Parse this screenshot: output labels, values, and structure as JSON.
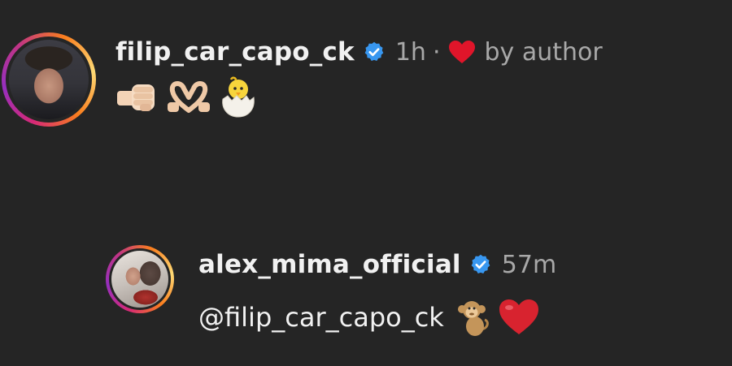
{
  "colors": {
    "background": "#252525",
    "username_text": "#f1f1f1",
    "secondary_text": "#a8a8a8",
    "verified_badge": "#3897f0",
    "heart": "#e0152a"
  },
  "comment": {
    "username": "filip_car_capo_ck",
    "verified_icon": "verified-badge-icon",
    "time": "1h",
    "separator": "·",
    "liked_icon": "heart-icon",
    "liked_label": "by author",
    "emojis": [
      "fist-bump-emoji",
      "heart-hands-emoji",
      "hatching-chick-emoji"
    ]
  },
  "reply": {
    "username": "alex_mima_official",
    "verified_icon": "verified-badge-icon",
    "time": "57m",
    "mention": "@filip_car_capo_ck",
    "emojis": [
      "monkey-emoji",
      "red-heart-emoji"
    ]
  }
}
